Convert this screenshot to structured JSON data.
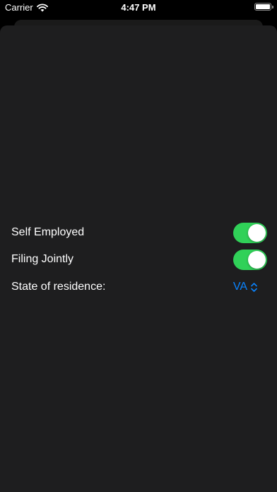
{
  "status_bar": {
    "carrier": "Carrier",
    "time": "4:47 PM",
    "wifi_icon": "wifi-icon",
    "battery_icon": "battery-icon"
  },
  "form": {
    "self_employed": {
      "label": "Self Employed",
      "on": true
    },
    "filing_jointly": {
      "label": "Filing Jointly",
      "on": true
    },
    "state": {
      "label": "State of residence:",
      "value": "VA",
      "icon": "chevron-up-down-icon"
    }
  },
  "colors": {
    "toggle_on": "#30d158",
    "accent": "#0a84ff",
    "sheet_background": "#1e1e1f"
  }
}
